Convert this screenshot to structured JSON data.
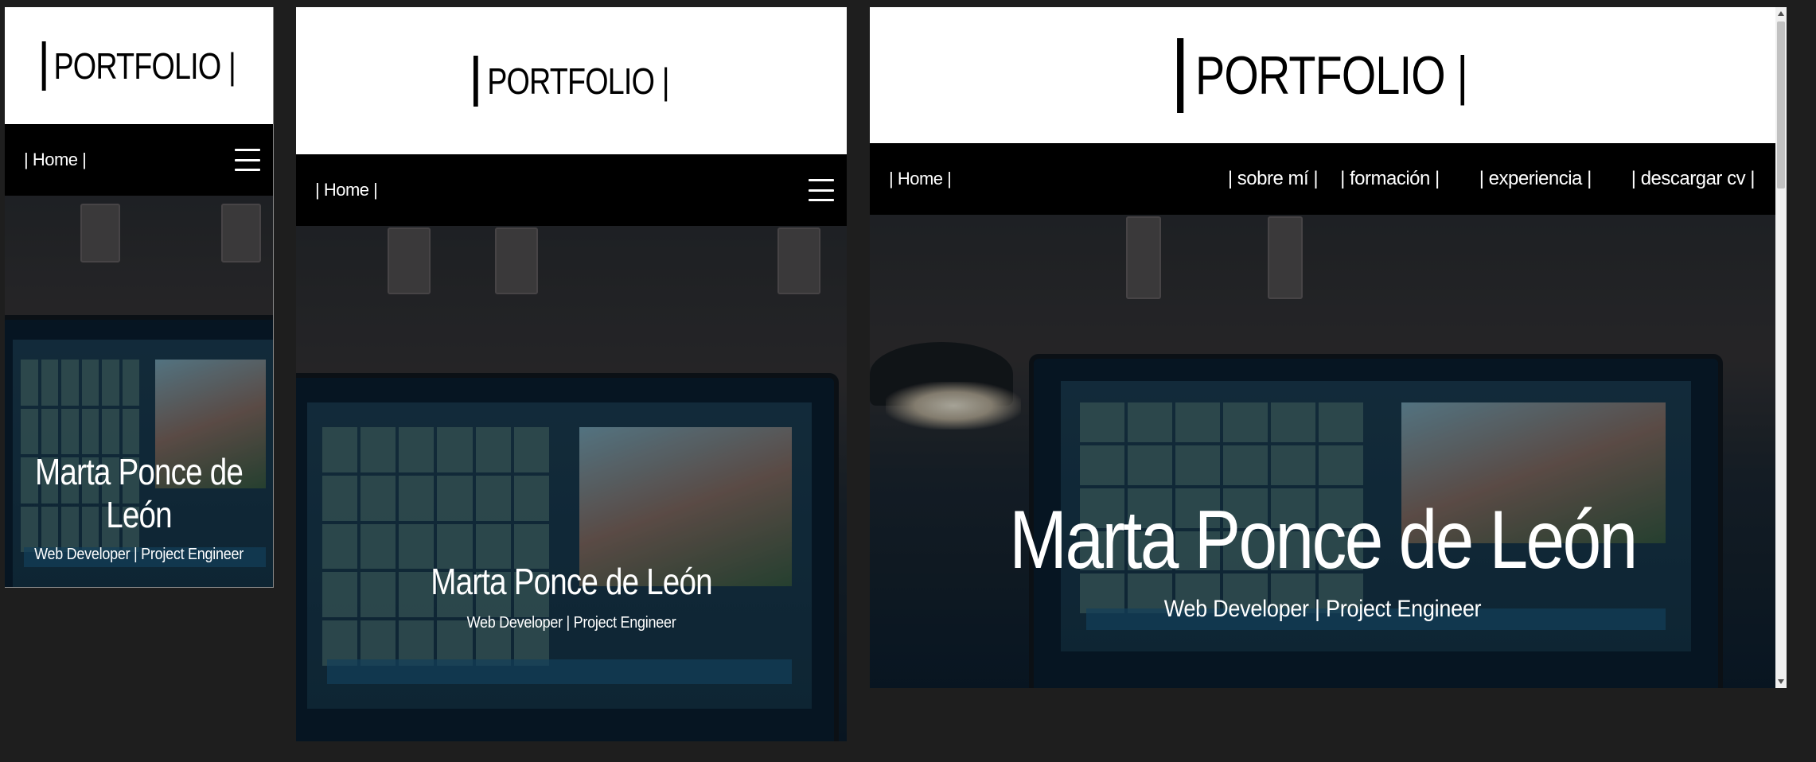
{
  "site": {
    "logo_text": "PORTFOLIO |",
    "nav_home": "| Home |",
    "nav_links": [
      "| sobre mí |",
      "| formación |",
      "| experiencia |",
      "| descargar cv |"
    ],
    "hero_name": "Marta Ponce de León",
    "hero_role": "Web Developer | Project Engineer"
  },
  "colors": {
    "page_background": "#1e1e1e",
    "header_background": "#ffffff",
    "navbar_background": "#000000",
    "navbar_text": "#ffffff",
    "hero_text": "#ffffff"
  },
  "icons": {
    "logo_bar": "vertical-bar-icon",
    "menu": "hamburger-menu-icon"
  },
  "viewports": [
    "mobile",
    "tablet",
    "desktop"
  ]
}
